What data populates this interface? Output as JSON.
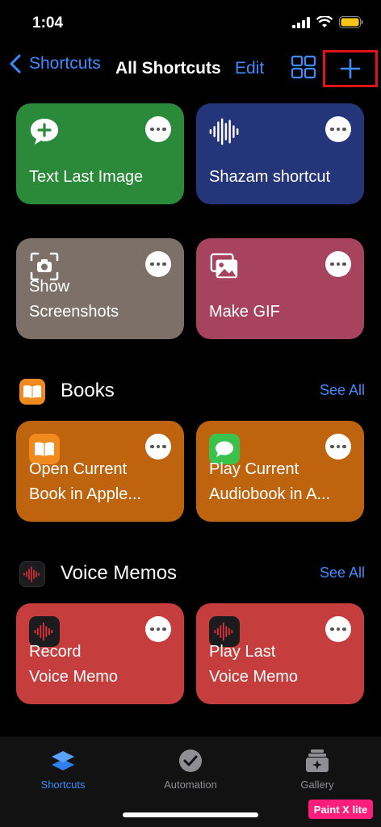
{
  "status_bar": {
    "time": "1:04"
  },
  "nav": {
    "back_label": "Shortcuts",
    "title": "All Shortcuts",
    "edit_label": "Edit"
  },
  "shortcuts": [
    {
      "label": "Text Last Image",
      "color": "#2b8a3a",
      "icon": "message-plus-icon"
    },
    {
      "label": "Shazam shortcut",
      "color": "#25357a",
      "icon": "waveform-icon"
    },
    {
      "label": "Show\nScreenshots",
      "color": "#7d7069",
      "icon": "camera-viewfinder-icon"
    },
    {
      "label": "Make GIF",
      "color": "#a8435f",
      "icon": "photos-stack-icon"
    }
  ],
  "sections": [
    {
      "title": "Books",
      "see_all": "See All",
      "icon": "books-app-icon",
      "items": [
        {
          "label": "Open Current\nBook in Apple...",
          "color": "#bf640e",
          "icon": "books-app-icon"
        },
        {
          "label": "Play Current\nAudiobook in A...",
          "color": "#bf640e",
          "icon": "messages-app-icon"
        }
      ]
    },
    {
      "title": "Voice Memos",
      "see_all": "See All",
      "icon": "voice-memos-app-icon",
      "items": [
        {
          "label": "Record\nVoice Memo",
          "color": "#c63d3d",
          "icon": "voice-memos-app-icon"
        },
        {
          "label": "Play Last\nVoice Memo",
          "color": "#c63d3d",
          "icon": "voice-memos-app-icon"
        }
      ]
    }
  ],
  "tabs": [
    {
      "label": "Shortcuts",
      "active": true,
      "icon": "shortcuts-stack-icon"
    },
    {
      "label": "Automation",
      "active": false,
      "icon": "clock-check-icon"
    },
    {
      "label": "Gallery",
      "active": false,
      "icon": "gallery-sparkle-icon"
    }
  ],
  "watermark": "Paint X lite",
  "colors": {
    "accent": "#3d8bff",
    "highlight_box": "#e0121a"
  }
}
